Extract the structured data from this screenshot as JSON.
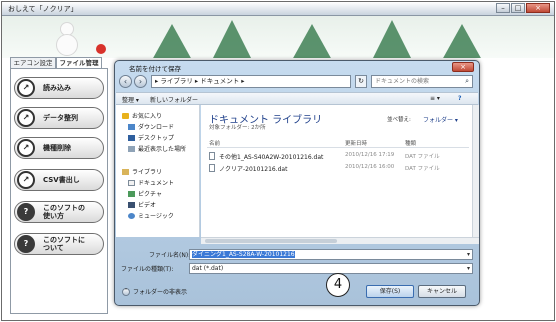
{
  "app": {
    "title": "おしえて「ノクリア」",
    "window_controls": [
      "–",
      "□",
      "×"
    ]
  },
  "tabs": [
    {
      "label": "エアコン設定"
    },
    {
      "label": "ファイル管理"
    }
  ],
  "sidebar": {
    "items": [
      {
        "label": "読み込み",
        "icon": "disc-icon"
      },
      {
        "label": "データ整列",
        "icon": "disc-icon"
      },
      {
        "label": "機種削除",
        "icon": "disc-icon"
      },
      {
        "label": "CSV書出し",
        "icon": "disc-icon"
      },
      {
        "label_line1": "このソフトの",
        "label_line2": "使い方",
        "icon": "question-icon"
      },
      {
        "label_line1": "このソフトに",
        "label_line2": "ついて",
        "icon": "question-icon"
      }
    ]
  },
  "dialog": {
    "title": "名前を付けて保存",
    "close_label": "×",
    "breadcrumb": "▸ ライブラリ ▸ ドキュメント ▸",
    "search_placeholder": "ドキュメントの検索",
    "toolbar": {
      "organize": "整理 ▾",
      "new_folder": "新しいフォルダー",
      "view": "≡ ▾",
      "help": "?"
    },
    "nav": [
      {
        "label": "お気に入り",
        "icon": "star-icon"
      },
      {
        "label": "ダウンロード",
        "icon": "download-icon"
      },
      {
        "label": "デスクトップ",
        "icon": "desktop-icon"
      },
      {
        "label": "最近表示した場所",
        "icon": "recent-icon"
      },
      {
        "label": "ライブラリ",
        "icon": "library-icon"
      },
      {
        "label": "ドキュメント",
        "icon": "document-icon"
      },
      {
        "label": "ピクチャ",
        "icon": "picture-icon"
      },
      {
        "label": "ビデオ",
        "icon": "video-icon"
      },
      {
        "label": "ミュージック",
        "icon": "music-icon"
      }
    ],
    "library": {
      "title": "ドキュメント ライブラリ",
      "subtitle": "対象フォルダー: 2か所",
      "arrange_label": "並べ替え:",
      "arrange_value": "フォルダー ▾"
    },
    "columns": {
      "name": "名前",
      "date": "更新日時",
      "type": "種類"
    },
    "files": [
      {
        "name": "その他1_AS-S40A2W-20101216.dat",
        "date": "2010/12/16 17:19",
        "type": "DAT ファイル"
      },
      {
        "name": "ノクリア-20101216.dat",
        "date": "2010/12/16 16:00",
        "type": "DAT ファイル"
      }
    ],
    "filename_label": "ファイル名(N):",
    "filename_value": "ダイニング1_AS-S28A-W-20101216",
    "filetype_label": "ファイルの種類(T):",
    "filetype_value": "dat (*.dat)",
    "hide_folders": "フォルダーの非表示",
    "save_label": "保存(S)",
    "cancel_label": "キャンセル"
  },
  "callout": "4"
}
